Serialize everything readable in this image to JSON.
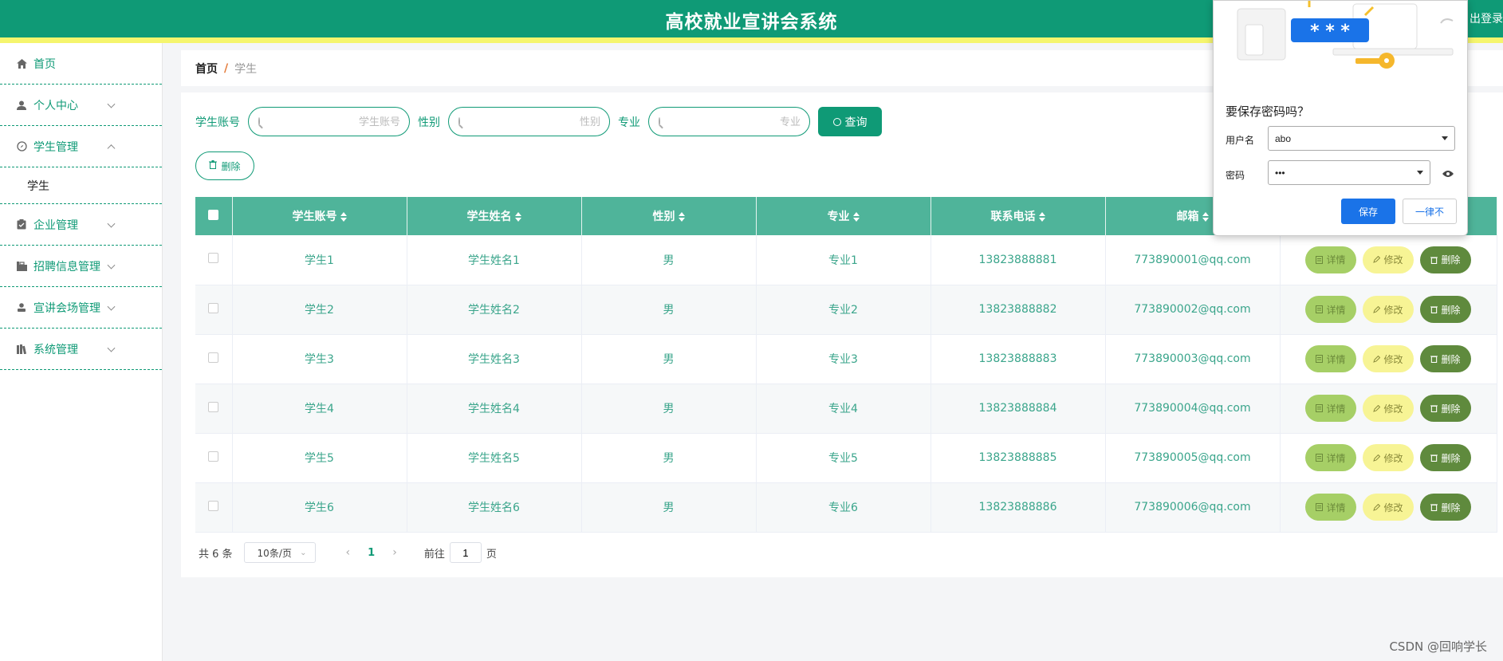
{
  "header": {
    "title": "高校就业宣讲会系统",
    "logout_partial": "出登录"
  },
  "sidebar": {
    "items": [
      {
        "label": "首页",
        "icon": "home-icon"
      },
      {
        "label": "个人中心",
        "icon": "user-icon"
      },
      {
        "label": "学生管理",
        "icon": "compass-icon",
        "expanded": true,
        "children": [
          {
            "label": "学生"
          }
        ]
      },
      {
        "label": "企业管理",
        "icon": "clipboard-icon"
      },
      {
        "label": "招聘信息管理",
        "icon": "briefcase-icon"
      },
      {
        "label": "宣讲会场管理",
        "icon": "person-icon"
      },
      {
        "label": "系统管理",
        "icon": "books-icon"
      }
    ]
  },
  "breadcrumb": {
    "home": "首页",
    "separator": "/",
    "current": "学生"
  },
  "search": {
    "account_label": "学生账号",
    "account_placeholder": "学生账号",
    "gender_label": "性别",
    "gender_placeholder": "性别",
    "major_label": "专业",
    "major_placeholder": "专业",
    "query_button": "查询"
  },
  "batch_delete_button": "删除",
  "table": {
    "headers": [
      "学生账号",
      "学生姓名",
      "性别",
      "专业",
      "联系电话",
      "邮箱",
      ""
    ],
    "rows": [
      {
        "account": "学生1",
        "name": "学生姓名1",
        "gender": "男",
        "major": "专业1",
        "phone": "13823888881",
        "email": "773890001@qq.com"
      },
      {
        "account": "学生2",
        "name": "学生姓名2",
        "gender": "男",
        "major": "专业2",
        "phone": "13823888882",
        "email": "773890002@qq.com"
      },
      {
        "account": "学生3",
        "name": "学生姓名3",
        "gender": "男",
        "major": "专业3",
        "phone": "13823888883",
        "email": "773890003@qq.com"
      },
      {
        "account": "学生4",
        "name": "学生姓名4",
        "gender": "男",
        "major": "专业4",
        "phone": "13823888884",
        "email": "773890004@qq.com"
      },
      {
        "account": "学生5",
        "name": "学生姓名5",
        "gender": "男",
        "major": "专业5",
        "phone": "13823888885",
        "email": "773890005@qq.com"
      },
      {
        "account": "学生6",
        "name": "学生姓名6",
        "gender": "男",
        "major": "专业6",
        "phone": "13823888886",
        "email": "773890006@qq.com"
      }
    ],
    "ops": {
      "detail": "详情",
      "edit": "修改",
      "delete": "删除"
    }
  },
  "pagination": {
    "total": "共 6 条",
    "page_size": "10条/页",
    "current_page": "1",
    "goto_prefix": "前往",
    "goto_value": "1",
    "goto_suffix": "页"
  },
  "password_popup": {
    "title": "要保存密码吗？",
    "username_label": "用户名",
    "username_value": "abo",
    "password_label": "密码",
    "password_value": "•••",
    "save_button": "保存",
    "never_button": "一律不",
    "illustration_text": "* * *"
  },
  "watermark": "CSDN @回响学长",
  "colors": {
    "primary": "#0f9a76",
    "header_stripe": "#f5f56d",
    "table_header": "#4fb49a",
    "detail": "#a6cf66",
    "edit": "#f7f495",
    "delete": "#5f8a3d"
  }
}
